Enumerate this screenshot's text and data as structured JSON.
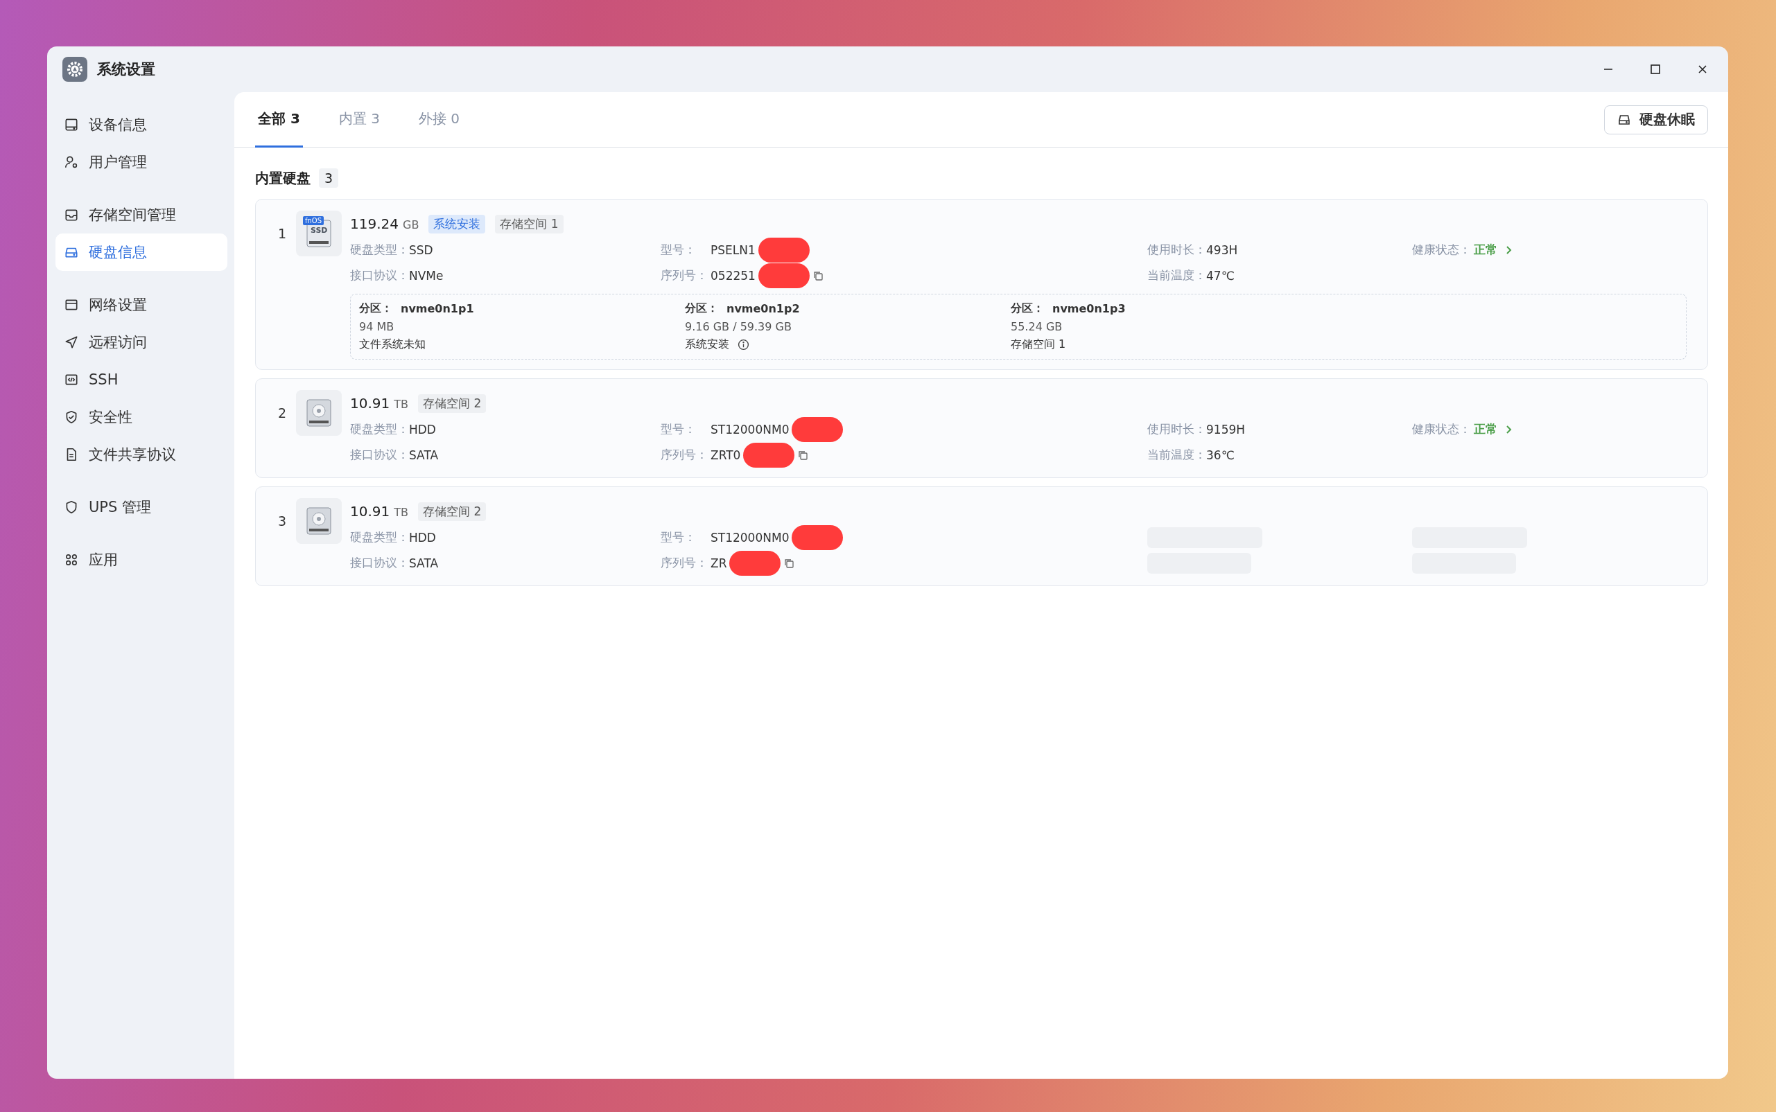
{
  "window": {
    "title": "系统设置"
  },
  "sidebar": {
    "groups": [
      {
        "items": [
          {
            "label": "设备信息",
            "selected": false
          },
          {
            "label": "用户管理",
            "selected": false
          }
        ]
      },
      {
        "items": [
          {
            "label": "存储空间管理",
            "selected": false
          },
          {
            "label": "硬盘信息",
            "selected": true
          }
        ]
      },
      {
        "items": [
          {
            "label": "网络设置",
            "selected": false
          },
          {
            "label": "远程访问",
            "selected": false
          },
          {
            "label": "SSH",
            "selected": false
          },
          {
            "label": "安全性",
            "selected": false
          },
          {
            "label": "文件共享协议",
            "selected": false
          }
        ]
      },
      {
        "items": [
          {
            "label": "UPS 管理",
            "selected": false
          }
        ]
      },
      {
        "items": [
          {
            "label": "应用",
            "selected": false
          }
        ]
      }
    ]
  },
  "tabs": [
    {
      "label": "全部 3",
      "selected": true
    },
    {
      "label": "内置 3",
      "selected": false
    },
    {
      "label": "外接 0",
      "selected": false
    }
  ],
  "sleep_button": {
    "label": "硬盘休眠"
  },
  "section": {
    "title": "内置硬盘",
    "count": "3"
  },
  "disks": [
    {
      "index": "1",
      "kind": "ssd",
      "icon": {
        "badge": "fnOS",
        "label": "SSD"
      },
      "size": "119.24",
      "unit": "GB",
      "loading": false,
      "tags": [
        {
          "label": "系统安装",
          "kind": "system"
        },
        {
          "label": "存储空间 1",
          "kind": "storage"
        }
      ],
      "info": [
        {
          "label": "硬盘类型：",
          "value": "SSD"
        },
        {
          "label": "接口协议：",
          "value": "NVMe"
        }
      ],
      "ids": [
        {
          "label": "型号：",
          "value": "PSELN1",
          "redacted": true,
          "copyable": false
        },
        {
          "label": "序列号：",
          "value": "052251",
          "redacted": true,
          "copyable": true
        }
      ],
      "stats": [
        {
          "label": "使用时长：",
          "value": "493H"
        },
        {
          "label": "当前温度：",
          "value": "47℃"
        }
      ],
      "health": {
        "label": "健康状态：",
        "value": "正常"
      },
      "partitions": [
        {
          "label": "分区：",
          "name": "nvme0n1p1",
          "size": "94 MB",
          "note": "文件系统未知",
          "info": false
        },
        {
          "label": "分区：",
          "name": "nvme0n1p2",
          "size": "9.16 GB / 59.39 GB",
          "note": "系统安装",
          "info": true
        },
        {
          "label": "分区：",
          "name": "nvme0n1p3",
          "size": "55.24 GB",
          "note": "存储空间 1",
          "info": false
        }
      ]
    },
    {
      "index": "2",
      "kind": "hdd",
      "size": "10.91",
      "unit": "TB",
      "loading": false,
      "tags": [
        {
          "label": "存储空间 2",
          "kind": "storage"
        }
      ],
      "info": [
        {
          "label": "硬盘类型：",
          "value": "HDD"
        },
        {
          "label": "接口协议：",
          "value": "SATA"
        }
      ],
      "ids": [
        {
          "label": "型号：",
          "value": "ST12000NM0",
          "redacted": true,
          "copyable": false
        },
        {
          "label": "序列号：",
          "value": "ZRT0",
          "redacted": true,
          "copyable": true
        }
      ],
      "stats": [
        {
          "label": "使用时长：",
          "value": "9159H"
        },
        {
          "label": "当前温度：",
          "value": "36℃"
        }
      ],
      "health": {
        "label": "健康状态：",
        "value": "正常"
      }
    },
    {
      "index": "3",
      "kind": "hdd",
      "size": "10.91",
      "unit": "TB",
      "loading": true,
      "tags": [
        {
          "label": "存储空间 2",
          "kind": "storage"
        }
      ],
      "info": [
        {
          "label": "硬盘类型：",
          "value": "HDD"
        },
        {
          "label": "接口协议：",
          "value": "SATA"
        }
      ],
      "ids": [
        {
          "label": "型号：",
          "value": "ST12000NM0",
          "redacted": true,
          "copyable": false
        },
        {
          "label": "序列号：",
          "value": "ZR",
          "redacted": true,
          "copyable": true
        }
      ]
    }
  ]
}
